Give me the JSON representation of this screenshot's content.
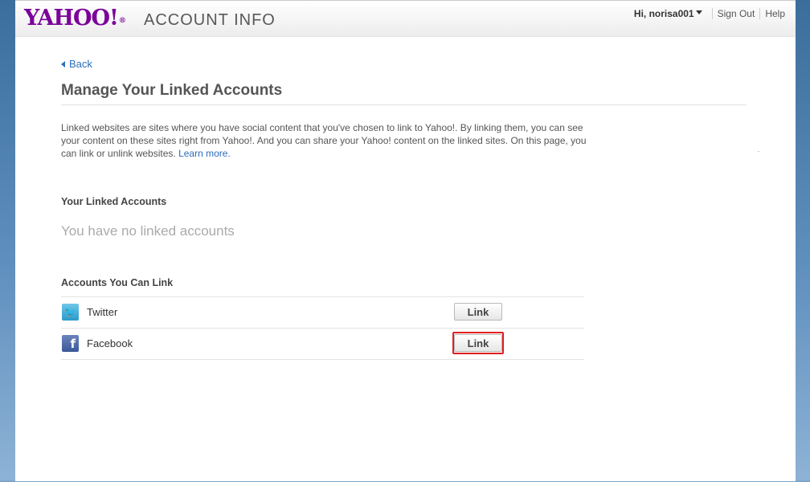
{
  "header": {
    "logo_text": "YAHOO!",
    "logo_mark": "®",
    "product_title": "ACCOUNT INFO",
    "greeting": "Hi, norisa001",
    "sign_out": "Sign Out",
    "help": "Help"
  },
  "nav": {
    "back_label": "Back"
  },
  "page": {
    "title": "Manage Your Linked Accounts",
    "description": "Linked websites are sites where you have social content that you've chosen to link to Yahoo!. By linking them, you can see your content on these sites right from Yahoo!. And you can share your Yahoo! content on the linked sites. On this page, you can link or unlink websites.",
    "learn_more": "Learn more."
  },
  "linked": {
    "heading": "Your Linked Accounts",
    "empty_message": "You have no linked accounts"
  },
  "available": {
    "heading": "Accounts You Can Link",
    "items": [
      {
        "name": "Twitter",
        "icon": "twitter-icon",
        "button": "Link"
      },
      {
        "name": "Facebook",
        "icon": "facebook-icon",
        "button": "Link"
      }
    ]
  },
  "colors": {
    "brand": "#7b0099",
    "link": "#2d6dbb",
    "highlight": "#e01f1f"
  }
}
